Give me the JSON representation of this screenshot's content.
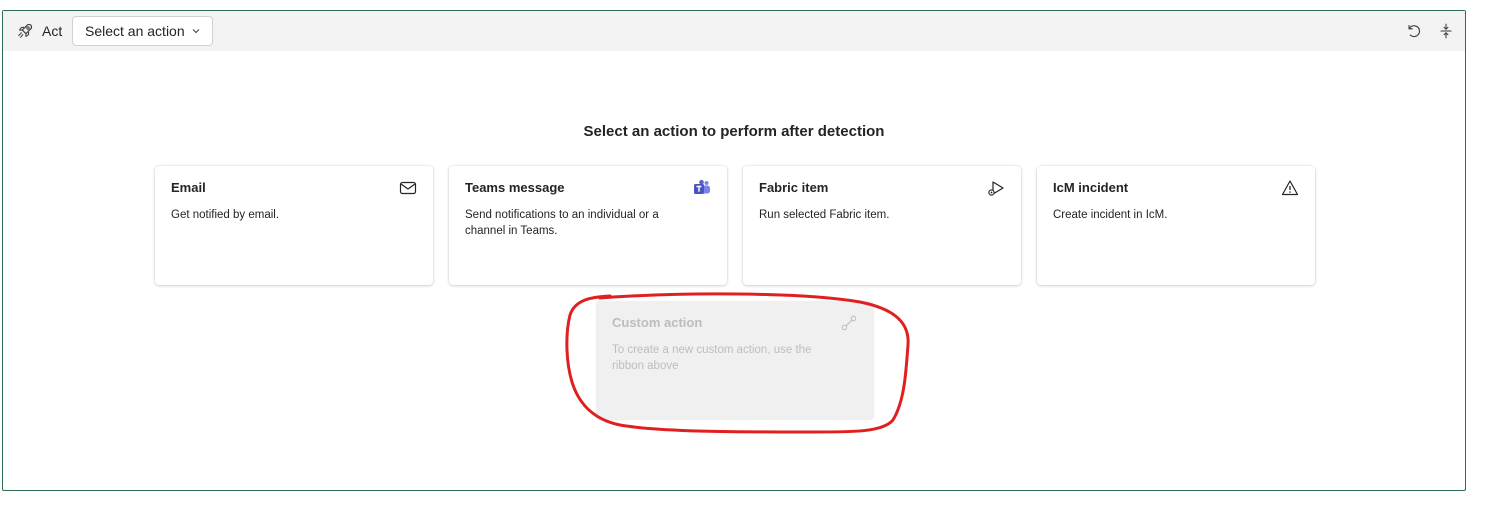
{
  "toolbar": {
    "title": "Act",
    "dropdown_label": "Select an action",
    "icons": {
      "act": "rocket-icon",
      "reset": "undo-icon",
      "collapse": "collapse-icon"
    }
  },
  "main": {
    "heading": "Select an action to perform after detection"
  },
  "cards": [
    {
      "title": "Email",
      "description": "Get notified by email.",
      "icon": "mail-icon"
    },
    {
      "title": "Teams message",
      "description": "Send notifications to an individual or a channel in Teams.",
      "icon": "teams-icon"
    },
    {
      "title": "Fabric item",
      "description": "Run selected Fabric item.",
      "icon": "run-item-icon"
    },
    {
      "title": "IcM incident",
      "description": "Create incident in IcM.",
      "icon": "warning-icon"
    }
  ],
  "custom_card": {
    "title": "Custom action",
    "description": "To create a new custom action, use the ribbon above",
    "icon": "link-icon",
    "disabled": true
  },
  "colors": {
    "panel_border": "#2f6b4f",
    "toolbar_bg": "#f3f3f3",
    "teams_brand": "#5b5fc7",
    "annotation": "#e02020"
  }
}
